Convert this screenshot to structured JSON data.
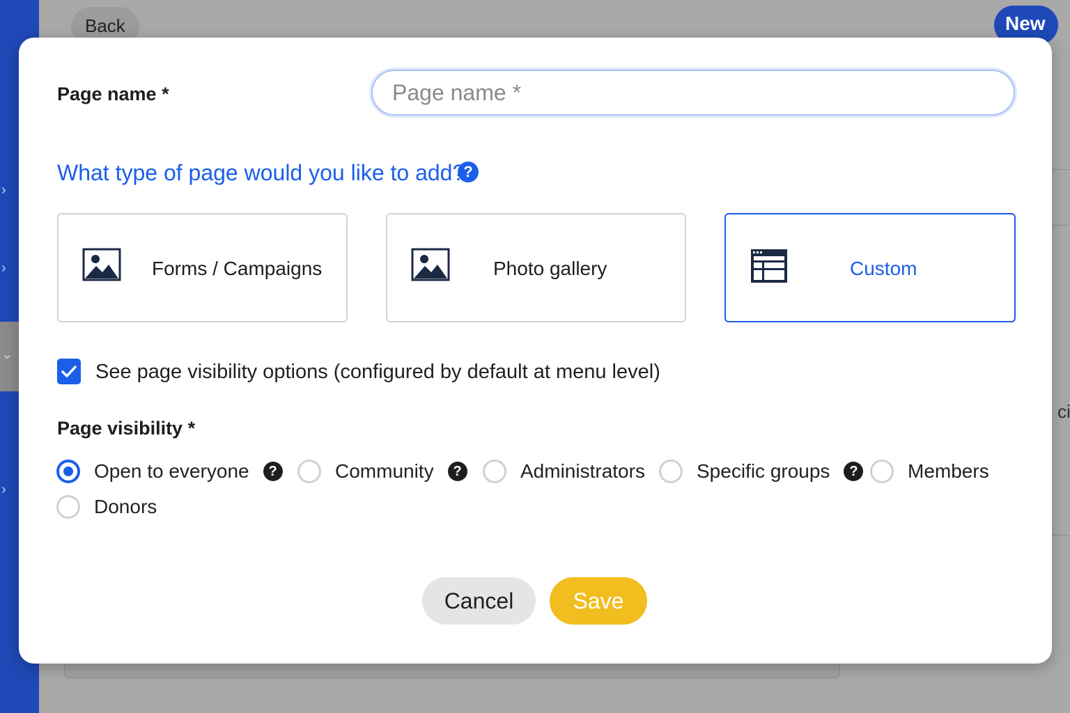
{
  "background": {
    "back_label": "Back",
    "new_label": "New",
    "partial_text": "ci",
    "sidebar_chevrons": [
      "›",
      "›",
      "⌄",
      "›"
    ]
  },
  "modal": {
    "page_name_label": "Page name *",
    "page_name_input": {
      "value": "",
      "placeholder": "Page name *"
    },
    "type_question": "What type of page would you like to add?",
    "help_symbol": "?",
    "page_types": [
      {
        "label": "Forms / Campaigns",
        "icon": "image-icon",
        "selected": false
      },
      {
        "label": "Photo gallery",
        "icon": "image-icon",
        "selected": false
      },
      {
        "label": "Custom",
        "icon": "layout-icon",
        "selected": true
      }
    ],
    "visibility_checkbox": {
      "label": "See page visibility options (configured by default at menu level)",
      "checked": true
    },
    "visibility_label": "Page visibility *",
    "visibility_options": [
      {
        "label": "Open to everyone",
        "selected": true,
        "help": true
      },
      {
        "label": "Community",
        "selected": false,
        "help": true
      },
      {
        "label": "Administrators",
        "selected": false,
        "help": false
      },
      {
        "label": "Specific groups",
        "selected": false,
        "help": true
      },
      {
        "label": "Members",
        "selected": false,
        "help": false
      },
      {
        "label": "Donors",
        "selected": false,
        "help": false
      }
    ],
    "cancel_label": "Cancel",
    "save_label": "Save"
  },
  "colors": {
    "accent": "#1b5ee8",
    "save_button": "#f1bd1f",
    "sidebar": "#1f49b8"
  }
}
